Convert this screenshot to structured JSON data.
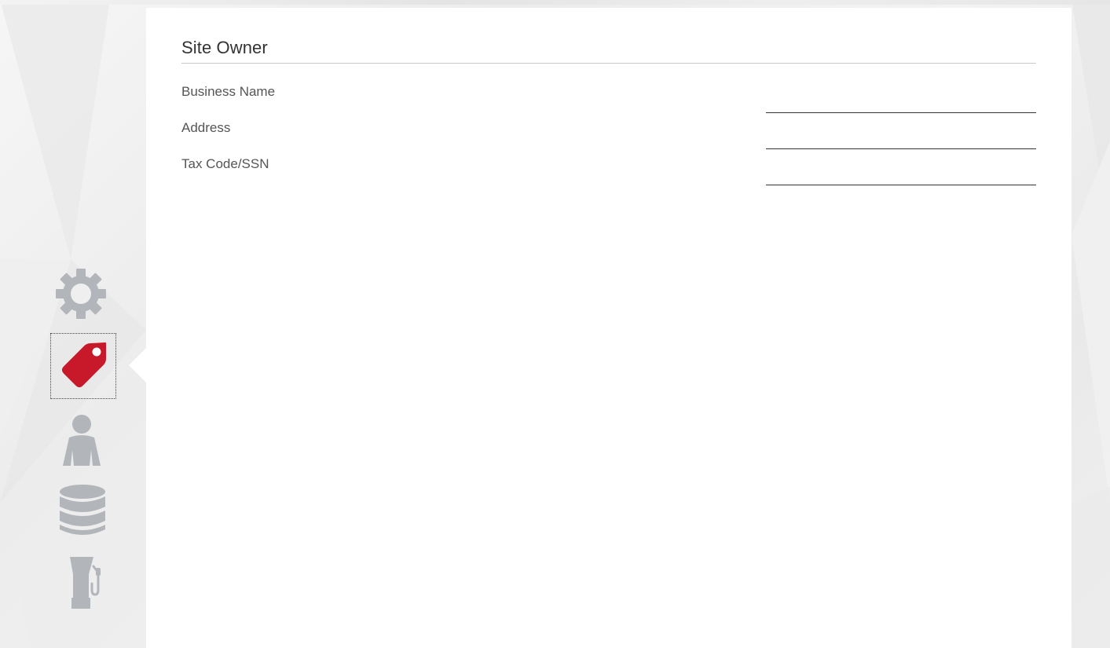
{
  "section": {
    "title": "Site Owner"
  },
  "fields": [
    {
      "label": "Business Name",
      "value": ""
    },
    {
      "label": "Address",
      "value": ""
    },
    {
      "label": "Tax Code/SSN",
      "value": ""
    }
  ],
  "sidebar": {
    "items": [
      {
        "icon": "gear-icon",
        "active": false
      },
      {
        "icon": "tag-icon",
        "active": true
      },
      {
        "icon": "person-icon",
        "active": false
      },
      {
        "icon": "database-icon",
        "active": false
      },
      {
        "icon": "fuel-pump-icon",
        "active": false
      }
    ]
  },
  "colors": {
    "accent": "#c8192a",
    "icon_inactive": "#b2b6ba",
    "text": "#555555",
    "title": "#333333"
  }
}
